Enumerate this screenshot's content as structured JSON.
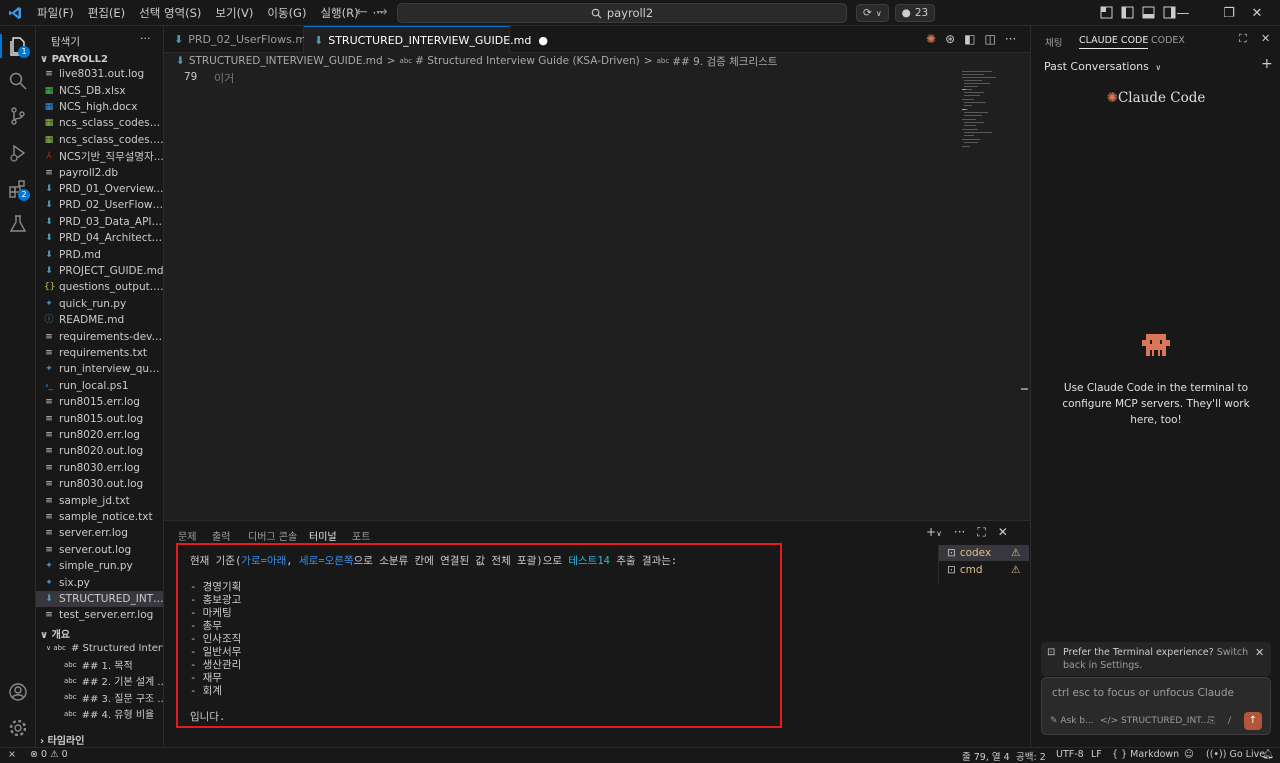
{
  "menu": {
    "items": [
      "파일(F)",
      "편집(E)",
      "선택 영역(S)",
      "보기(V)",
      "이동(G)",
      "실행(R)",
      "···"
    ],
    "search": "payroll2",
    "count": "23"
  },
  "activity": {
    "explorer_badge": "1",
    "extensions_badge": "2"
  },
  "sidebar": {
    "title": "탐색기",
    "more": "···",
    "project": "PAYROLL2",
    "files": [
      {
        "name": "live8031.out.log",
        "icon": "log"
      },
      {
        "name": "NCS_DB.xlsx",
        "icon": "xlsx"
      },
      {
        "name": "NCS_high.docx",
        "icon": "docx"
      },
      {
        "name": "ncs_sclass_codes_with...",
        "icon": "csv"
      },
      {
        "name": "ncs_sclass_codes.csv",
        "icon": "csv"
      },
      {
        "name": "NCS기반_직무설명자...",
        "icon": "pdf"
      },
      {
        "name": "payroll2.db",
        "icon": "log"
      },
      {
        "name": "PRD_01_Overview.md",
        "icon": "md"
      },
      {
        "name": "PRD_02_UserFlows.md",
        "icon": "md"
      },
      {
        "name": "PRD_03_Data_API.md",
        "icon": "md"
      },
      {
        "name": "PRD_04_Architecture....",
        "icon": "md"
      },
      {
        "name": "PRD.md",
        "icon": "md"
      },
      {
        "name": "PROJECT_GUIDE.md",
        "icon": "md"
      },
      {
        "name": "questions_output.json",
        "icon": "json"
      },
      {
        "name": "quick_run.py",
        "icon": "py"
      },
      {
        "name": "README.md",
        "icon": "info"
      },
      {
        "name": "requirements-dev.txt",
        "icon": "log"
      },
      {
        "name": "requirements.txt",
        "icon": "log"
      },
      {
        "name": "run_interview_questio...",
        "icon": "py"
      },
      {
        "name": "run_local.ps1",
        "icon": "ps"
      },
      {
        "name": "run8015.err.log",
        "icon": "log"
      },
      {
        "name": "run8015.out.log",
        "icon": "log"
      },
      {
        "name": "run8020.err.log",
        "icon": "log"
      },
      {
        "name": "run8020.out.log",
        "icon": "log"
      },
      {
        "name": "run8030.err.log",
        "icon": "log"
      },
      {
        "name": "run8030.out.log",
        "icon": "log"
      },
      {
        "name": "sample_jd.txt",
        "icon": "log"
      },
      {
        "name": "sample_notice.txt",
        "icon": "log"
      },
      {
        "name": "server.err.log",
        "icon": "log"
      },
      {
        "name": "server.out.log",
        "icon": "log"
      },
      {
        "name": "simple_run.py",
        "icon": "py"
      },
      {
        "name": "six.py",
        "icon": "py"
      },
      {
        "name": "STRUCTURED_INTERVI...",
        "icon": "md"
      },
      {
        "name": "test_server.err.log",
        "icon": "log"
      }
    ],
    "outline_title": "개요",
    "outline": [
      "# Structured Interv...",
      "## 1. 목적",
      "## 2. 기본 설계 ...",
      "## 3. 질문 구조 ...",
      "## 4. 유형 비율"
    ],
    "timeline_title": "타임라인"
  },
  "tabs": [
    {
      "label": "PRD_02_UserFlows.md"
    },
    {
      "label": "STRUCTURED_INTERVIEW_GUIDE.md"
    }
  ],
  "breadcrumb": {
    "file": "STRUCTURED_INTERVIEW_GUIDE.md",
    "sep": ">",
    "h1": "# Structured Interview Guide (KSA-Driven)",
    "h2": "## 9. 검증 체크리스트"
  },
  "editor": {
    "line_number": "79",
    "line_text": "이거"
  },
  "panel": {
    "tabs": [
      "문제",
      "출력",
      "디버그 콘솔",
      "터미널",
      "포트"
    ],
    "terminal": {
      "intro_a": "현재 기준(",
      "intro_b": "가로=아래",
      "intro_c": ", ",
      "intro_d": "세로=오른쪽",
      "intro_e": "으로 소분류 칸에 연결된 값 전체 포괄)으로 ",
      "intro_f": "테스트14",
      "intro_g": " 추출 결과는:",
      "items": [
        "- 경영기획",
        "- 홍보광고",
        "- 마케팅",
        "- 총무",
        "- 인사조직",
        "- 일반서무",
        "- 생산관리",
        "- 재무",
        "- 회계"
      ],
      "outro": "입니다."
    },
    "terminals": [
      "codex",
      "cmd"
    ]
  },
  "right": {
    "tabs": [
      "채팅",
      "CLAUDE CODE",
      "CODEX"
    ],
    "past_conversations": "Past Conversations",
    "brand": "Claude Code",
    "message": "Use Claude Code in the terminal to configure MCP servers. They'll work here, too!",
    "notice_a": "Prefer the Terminal experience?",
    "notice_b": "Switch back in Settings.",
    "input_placeholder": "ctrl esc to focus or unfocus Claude",
    "tool_ask": "Ask b...",
    "tool_file": "STRUCTURED_INT...",
    "tool_slash": "/"
  },
  "status": {
    "errors": "0",
    "warnings": "0",
    "position": "줄 79, 열 4",
    "spaces": "공백: 2",
    "encoding": "UTF-8",
    "eol": "LF",
    "language": "Markdown",
    "golive": "Go Live"
  },
  "colors": {
    "accent": "#0078d4",
    "highlight_box": "#e51b1b",
    "claude": "#d97757"
  }
}
